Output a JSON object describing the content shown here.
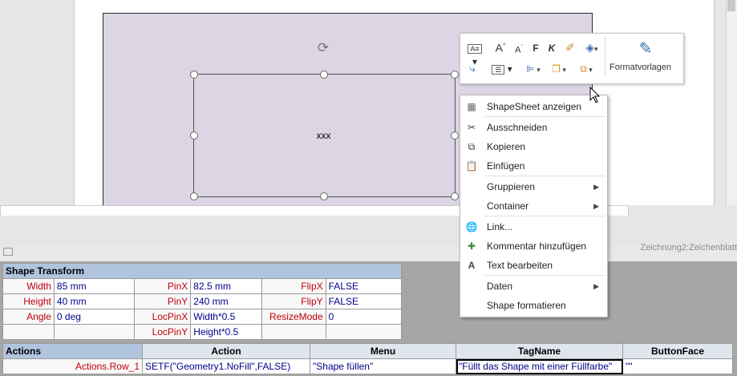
{
  "canvas": {
    "shape_text": "xxx",
    "status_text": "Zeichnung2:Zeichenblatt"
  },
  "mini_toolbar": {
    "items": [
      {
        "icon": "text-style-icon",
        "glyph": "A̲"
      },
      {
        "icon": "increase-font-icon",
        "glyph": "A˄"
      },
      {
        "icon": "decrease-font-icon",
        "glyph": "A˅"
      },
      {
        "icon": "bold-icon",
        "glyph": "F"
      },
      {
        "icon": "italic-icon",
        "glyph": "K"
      },
      {
        "icon": "format-painter-icon",
        "glyph": "✐"
      },
      {
        "icon": "fill-color-icon",
        "glyph": "◈"
      },
      {
        "icon": "connector-icon",
        "glyph": "⤷"
      },
      {
        "icon": "align-text-icon",
        "glyph": "☰"
      },
      {
        "icon": "position-icon",
        "glyph": "⊫"
      },
      {
        "icon": "arrange-icon",
        "glyph": "❐"
      },
      {
        "icon": "group-icon",
        "glyph": "⧉"
      },
      {
        "icon": "pointer-icon",
        "glyph": "▾"
      }
    ],
    "format_styles_label": "Formatvorlagen"
  },
  "context_menu": {
    "items": [
      {
        "label": "ShapeSheet anzeigen",
        "icon": "shapesheet-icon"
      },
      {
        "label": "Ausschneiden",
        "icon": "scissors-icon"
      },
      {
        "label": "Kopieren",
        "icon": "copy-icon"
      },
      {
        "label": "Einfügen",
        "icon": "paste-icon"
      },
      {
        "label": "Gruppieren",
        "icon": "",
        "submenu": true
      },
      {
        "label": "Container",
        "icon": "",
        "submenu": true
      },
      {
        "label": "Link...",
        "icon": "globe-link-icon"
      },
      {
        "label": "Kommentar hinzufügen",
        "icon": "add-comment-icon"
      },
      {
        "label": "Text bearbeiten",
        "icon": "text-edit-icon"
      },
      {
        "label": "Daten",
        "icon": "",
        "submenu": true
      },
      {
        "label": "Shape formatieren",
        "icon": ""
      }
    ]
  },
  "shape_transform": {
    "title": "Shape Transform",
    "rows": [
      [
        {
          "n": "Width",
          "v": "85 mm"
        },
        {
          "n": "PinX",
          "v": "82.5 mm"
        },
        {
          "n": "FlipX",
          "v": "FALSE"
        }
      ],
      [
        {
          "n": "Height",
          "v": "40 mm"
        },
        {
          "n": "PinY",
          "v": "240 mm"
        },
        {
          "n": "FlipY",
          "v": "FALSE"
        }
      ],
      [
        {
          "n": "Angle",
          "v": "0 deg"
        },
        {
          "n": "LocPinX",
          "v": "Width*0.5"
        },
        {
          "n": "ResizeMode",
          "v": "0"
        }
      ],
      [
        {
          "n": "",
          "v": ""
        },
        {
          "n": "LocPinY",
          "v": "Height*0.5"
        },
        {
          "n": "",
          "v": ""
        }
      ]
    ]
  },
  "actions": {
    "title": "Actions",
    "headers": [
      "Action",
      "Menu",
      "TagName",
      "ButtonFace"
    ],
    "row": {
      "name": "Actions.Row_1",
      "action": "SETF(\"Geometry1.NoFill\",FALSE)",
      "menu": "\"Shape füllen\"",
      "tagname": "\"Füllt das Shape mit einer Füllfarbe\"",
      "buttonface": "\"\""
    }
  }
}
